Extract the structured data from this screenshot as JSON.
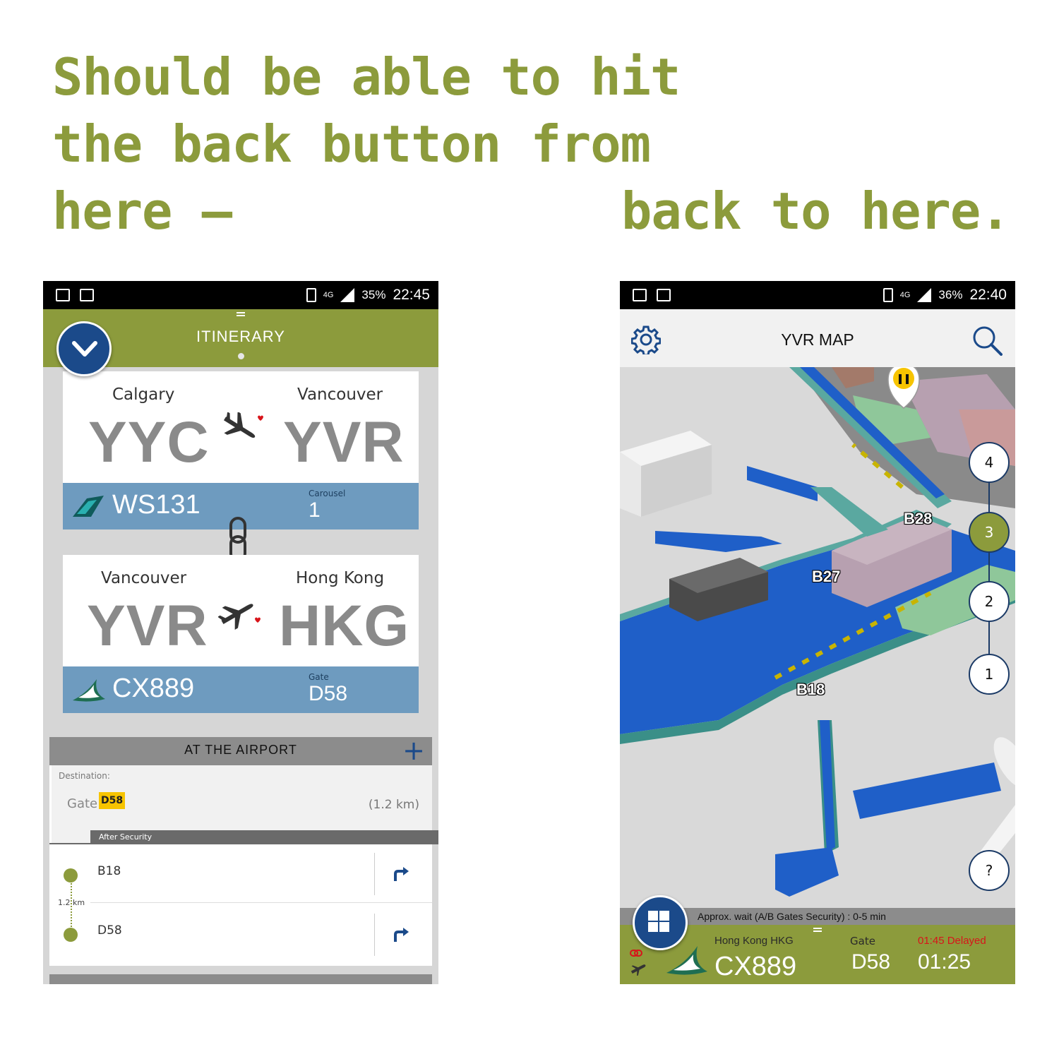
{
  "caption": {
    "line1": "Should be able to hit",
    "line2": "the back button from",
    "line3": "here –",
    "line3_right": "back to here."
  },
  "left_phone": {
    "status": {
      "network": "4G",
      "battery": "35%",
      "time": "22:45"
    },
    "header": {
      "title": "ITINERARY"
    },
    "segments": [
      {
        "from_city": "Calgary",
        "from_code": "YYC",
        "to_city": "Vancouver",
        "to_code": "YVR",
        "flight": "WS131",
        "info_label": "Carousel",
        "info_value": "1"
      },
      {
        "from_city": "Vancouver",
        "from_code": "YVR",
        "to_city": "Hong Kong",
        "to_code": "HKG",
        "flight": "CX889",
        "info_label": "Gate",
        "info_value": "D58"
      }
    ],
    "airport": {
      "title": "AT THE AIRPORT",
      "destination_label": "Destination:",
      "gate_label": "Gate",
      "gate_value": "D58",
      "distance": "(1.2 km)",
      "section_label": "After Security",
      "route": [
        {
          "name": "B18"
        },
        {
          "name": "D58"
        }
      ],
      "route_distance": "1.2 km"
    }
  },
  "right_phone": {
    "status": {
      "network": "4G",
      "battery": "36%",
      "time": "22:40"
    },
    "header": {
      "title": "YVR MAP"
    },
    "map": {
      "gates": [
        "B28",
        "B27",
        "B18"
      ],
      "floors": [
        "4",
        "3",
        "2",
        "1"
      ],
      "active_floor": "3",
      "help_label": "?"
    },
    "wait": "Approx. wait (A/B Gates Security) : 0-5 min",
    "flight_bar": {
      "destination": "Hong Kong HKG",
      "flight": "CX889",
      "gate_label": "Gate",
      "gate": "D58",
      "delay": "01:45 Delayed",
      "time": "01:25"
    }
  },
  "colors": {
    "accent_green": "#8c9b3c",
    "brand_blue": "#1b4a8a",
    "band_blue": "#6e9bbf",
    "delay_red": "#d8141a",
    "gate_yellow": "#f7c400"
  }
}
